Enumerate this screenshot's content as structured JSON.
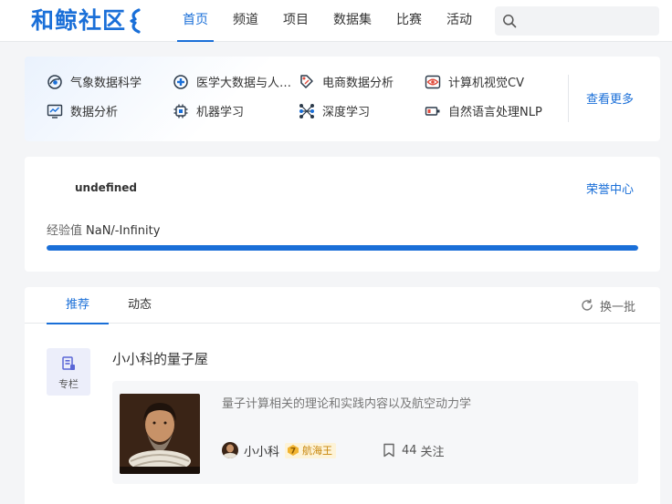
{
  "header": {
    "logo_text": "和鲸社区",
    "nav": [
      {
        "label": "首页",
        "active": true
      },
      {
        "label": "频道"
      },
      {
        "label": "项目"
      },
      {
        "label": "数据集"
      },
      {
        "label": "比赛"
      },
      {
        "label": "活动"
      }
    ],
    "search": {
      "placeholder": "",
      "icon": "search-icon"
    }
  },
  "categories": {
    "items": [
      {
        "label": "气象数据科学",
        "icon": "weather-icon"
      },
      {
        "label": "医学大数据与人工智能",
        "icon": "medical-icon"
      },
      {
        "label": "电商数据分析",
        "icon": "ecommerce-icon"
      },
      {
        "label": "计算机视觉CV",
        "icon": "vision-icon"
      },
      {
        "label": "数据分析",
        "icon": "data-analysis-icon"
      },
      {
        "label": "机器学习",
        "icon": "machine-learning-icon"
      },
      {
        "label": "深度学习",
        "icon": "deep-learning-icon"
      },
      {
        "label": "自然语言处理NLP",
        "icon": "nlp-icon"
      }
    ],
    "see_more": "查看更多"
  },
  "experience": {
    "username": "undefined",
    "honor_center": "荣誉中心",
    "label": "经验值",
    "value": "NaN/-Infinity",
    "progress": 1.0
  },
  "feed": {
    "tabs": [
      {
        "label": "推荐",
        "active": true
      },
      {
        "label": "动态"
      }
    ],
    "refresh_label": "换一批",
    "post": {
      "badge_label": "专栏",
      "title": "小小科的量子屋",
      "description": "量子计算相关的理论和实践内容以及航空动力学",
      "author": "小小科",
      "rank_level": "7",
      "rank_label": "航海王",
      "follow_count": "44",
      "follow_label": "关注"
    }
  },
  "colors": {
    "accent": "#1a6fd8",
    "rank_text": "#c8860a",
    "rank_bg": "#fdf3d8"
  }
}
